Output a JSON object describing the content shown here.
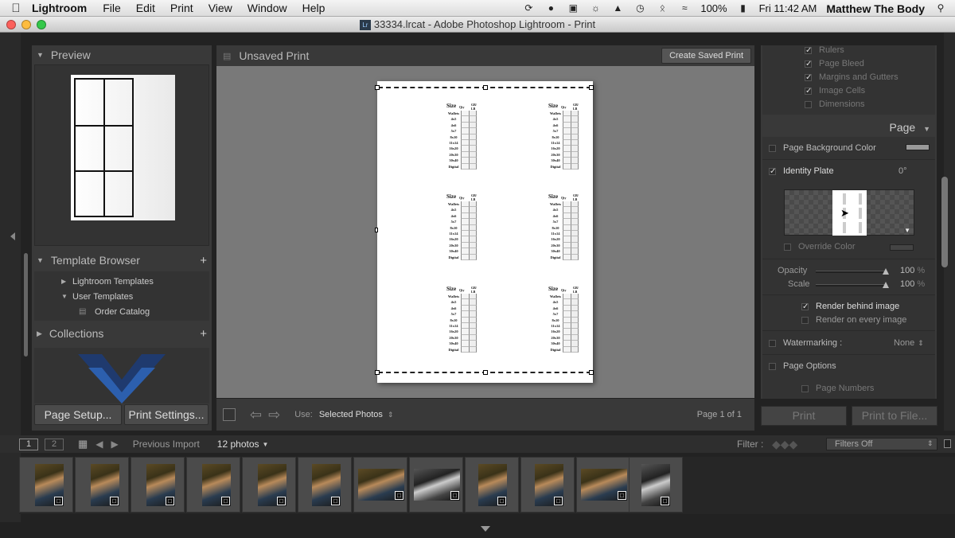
{
  "menubar": {
    "app": "Lightroom",
    "items": [
      "File",
      "Edit",
      "Print",
      "View",
      "Window",
      "Help"
    ],
    "battery": "100%",
    "clock": "Fri 11:42 AM",
    "user": "Matthew The Body"
  },
  "window": {
    "title": "33334.lrcat - Adobe Photoshop Lightroom - Print",
    "lr_badge": "Lr"
  },
  "left": {
    "preview_label": "Preview",
    "template_browser_label": "Template Browser",
    "templates": [
      {
        "label": "Lightroom Templates",
        "tri": "▶"
      },
      {
        "label": "User Templates",
        "tri": "▼"
      },
      {
        "label": "Order Catalog",
        "tri": ""
      }
    ],
    "collections_label": "Collections",
    "page_setup": "Page Setup...",
    "print_settings": "Print Settings..."
  },
  "center": {
    "title": "Unsaved Print",
    "create_saved_print": "Create Saved Print",
    "use_label": "Use:",
    "use_value": "Selected Photos",
    "page_of": "Page 1 of 1"
  },
  "order_card": {
    "size": "Size",
    "qty": "Qty",
    "gb": "GB/ LB",
    "rows": [
      "Wallets",
      "4x5",
      "4x6",
      "5x7",
      "8x10",
      "11x14",
      "16x20",
      "20x30",
      "30x40",
      "Digital"
    ]
  },
  "right": {
    "guides": [
      {
        "label": "Rulers",
        "checked": true
      },
      {
        "label": "Page Bleed",
        "checked": true
      },
      {
        "label": "Margins and Gutters",
        "checked": true
      },
      {
        "label": "Image Cells",
        "checked": true
      },
      {
        "label": "Dimensions",
        "checked": false
      }
    ],
    "page_title": "Page",
    "page_bg_color": "Page Background Color",
    "identity_plate": "Identity Plate",
    "identity_angle": "0°",
    "override_color": "Override Color",
    "opacity_label": "Opacity",
    "opacity_value": "100",
    "scale_label": "Scale",
    "scale_value": "100",
    "percent": "%",
    "render_behind": "Render behind image",
    "render_every": "Render on every image",
    "watermarking": "Watermarking :",
    "watermark_value": "None",
    "page_options": "Page Options",
    "page_numbers": "Page Numbers",
    "print_btn": "Print",
    "print_to_file": "Print to File..."
  },
  "filmstrip": {
    "screen1": "1",
    "screen2": "2",
    "source": "Previous Import",
    "count": "12 photos",
    "filter_label": "Filter :",
    "filter_value": "Filters Off",
    "photos": [
      {
        "tone": "color"
      },
      {
        "tone": "color"
      },
      {
        "tone": "color"
      },
      {
        "tone": "color"
      },
      {
        "tone": "color"
      },
      {
        "tone": "color"
      },
      {
        "tone": "color"
      },
      {
        "tone": "bw"
      },
      {
        "tone": "color"
      },
      {
        "tone": "color"
      },
      {
        "tone": "color"
      },
      {
        "tone": "bw"
      }
    ]
  }
}
